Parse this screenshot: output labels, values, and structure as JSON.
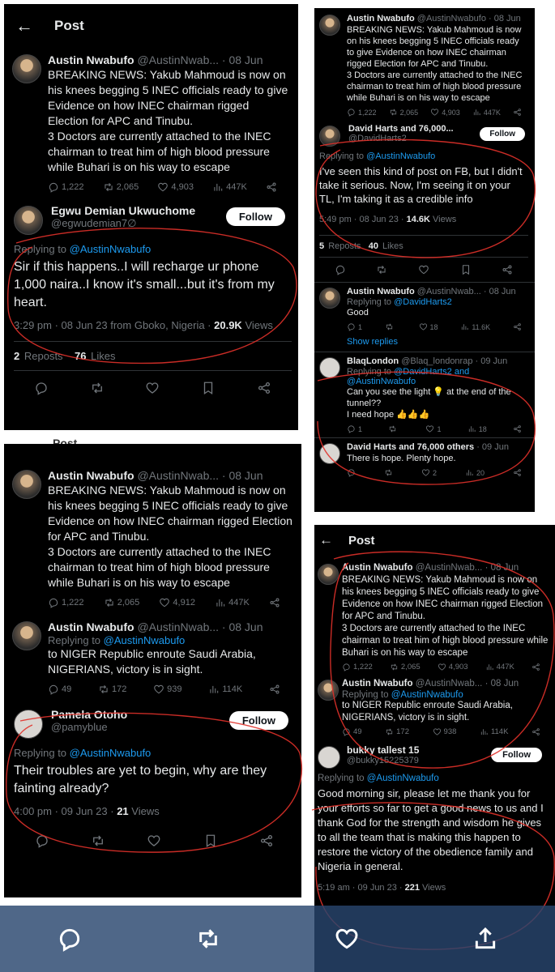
{
  "header": {
    "title": "Post"
  },
  "main_tweet": {
    "name": "Austin Nwabufo",
    "handle": "@AustinNwab...",
    "date": "· 08 Jun",
    "text": "BREAKING NEWS: Yakub Mahmoud is now on his knees begging 5 INEC officials ready to give Evidence on how INEC chairman rigged Election for APC and Tinubu.\n3 Doctors are currently attached to the INEC chairman to treat him of high blood pressure while Buhari is on his way to escape",
    "replies": "1,222",
    "reposts": "2,065",
    "likes": "4,903",
    "views": "447K"
  },
  "panel1": {
    "reply": {
      "name": "Egwu Demian Ukwuchome",
      "handle": "@egwudemian7∅",
      "follow": "Follow",
      "replying_prefix": "Replying to ",
      "replying_to": "@AustinNwabufo",
      "text": "Sir if this happens..I will recharge ur phone 1,000 naira..I know it's small...but it's from my heart.",
      "meta": "3:29 pm · 08 Jun 23 from Gboko, Nigeria · ",
      "views_count": "20.9K",
      "views_label": "Views",
      "reposts_count": "2",
      "reposts_label": "Reposts",
      "likes_count": "76",
      "likes_label": "Likes"
    }
  },
  "panel2": {
    "main": {
      "name": "Austin Nwabufo",
      "handle": "@AustinNwabufo",
      "date": "· 08 Jun",
      "replies": "1,222",
      "reposts": "2,065",
      "likes": "4,903",
      "views": "447K"
    },
    "reply": {
      "name": "David Harts and 76,000...",
      "handle": "@DavidHarts2",
      "follow": "Follow",
      "replying_prefix": "Replying to ",
      "replying_to": "@AustinNwabufo",
      "text": "I've seen this kind of post on FB, but I didn't take it serious. Now, I'm seeing it on your TL, I'm taking it as a credible info",
      "meta": "5:49 pm · 08 Jun 23 · ",
      "views_count": "14.6K",
      "views_label": "Views",
      "reposts_count": "5",
      "reposts_label": "Reposts",
      "likes_count": "40",
      "likes_label": "Likes"
    },
    "r1": {
      "name": "Austin Nwabufo",
      "handle": "@AustinNwab...",
      "date": "· 08 Jun",
      "replying_prefix": "Replying to ",
      "replying_to": "@DavidHarts2",
      "text": "Good",
      "replies": "1",
      "reposts": "",
      "likes": "18",
      "views": "11.6K",
      "show_replies": "Show replies"
    },
    "r2": {
      "name": "BlaqLondon",
      "handle": "@Blaq_londonrap",
      "date": "· 09 Jun",
      "replying_prefix": "Replying to ",
      "replying_to": "@DavidHarts2 and @AustinNwabufo",
      "text": "Can you see the light 💡 at the end of the tunnel??\nI need hope 👍👍👍",
      "replies": "1",
      "reposts": "",
      "likes": "1",
      "views": "18"
    },
    "r3": {
      "name": "David Harts and 76,000 others",
      "handle": "",
      "date": "· 09 Jun",
      "text": "There is hope. Plenty hope.",
      "replies": "",
      "reposts": "",
      "likes": "2",
      "views": "20"
    }
  },
  "panel3": {
    "header_fragment": "Post",
    "main": {
      "replies": "1,222",
      "reposts": "2,065",
      "likes": "4,912",
      "views": "447K"
    },
    "thread": {
      "name": "Austin Nwabufo",
      "handle": "@AustinNwab...",
      "date": "· 08 Jun",
      "replying_prefix": "Replying to ",
      "replying_to": "@AustinNwabufo",
      "text": "to NIGER Republic enroute Saudi Arabia, NIGERIANS, victory is in sight.",
      "replies": "49",
      "reposts": "172",
      "likes": "939",
      "views": "114K"
    },
    "reply": {
      "name": "Pamela Otoho",
      "handle": "@pamyblue",
      "follow": "Follow",
      "replying_prefix": "Replying to ",
      "replying_to": "@AustinNwabufo",
      "text": "Their troubles are yet to begin, why are they fainting already?",
      "meta": "4:00 pm · 09 Jun 23 · ",
      "views_count": "21",
      "views_label": "Views"
    }
  },
  "panel4": {
    "title": "Post",
    "main": {
      "replies": "1,222",
      "reposts": "2,065",
      "likes": "4,903",
      "views": "447K"
    },
    "thread": {
      "name": "Austin Nwabufo",
      "handle": "@AustinNwab...",
      "date": "· 08 Jun",
      "replying_prefix": "Replying to ",
      "replying_to": "@AustinNwabufo",
      "text": "to NIGER Republic enroute Saudi Arabia, NIGERIANS, victory is in sight.",
      "replies": "49",
      "reposts": "172",
      "likes": "938",
      "views": "114K"
    },
    "reply": {
      "name": "bukky tallest 15",
      "handle": "@bukky15225379",
      "follow": "Follow",
      "replying_prefix": "Replying to ",
      "replying_to": "@AustinNwabufo",
      "text": "Good morning sir, please let me thank you for your efforts so far to get a good news to us and I thank God for the strength and wisdom he gives to all the team that is making this happen to restore the victory of the obedience family and Nigeria in general.",
      "meta": "5:19 am · 09 Jun 23 · ",
      "views_count": "221",
      "views_label": "Views"
    }
  },
  "colors": {
    "background": "#000000",
    "text": "#e7e9ea",
    "muted": "#71767b",
    "link": "#1d9bf0",
    "annotation": "#e0312a",
    "nav": "#28466e"
  },
  "icons": [
    "back-arrow-icon",
    "reply-icon",
    "repost-icon",
    "like-icon",
    "views-icon",
    "share-icon",
    "bookmark-icon",
    "upload-icon"
  ]
}
